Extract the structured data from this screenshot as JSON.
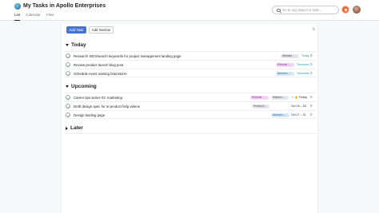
{
  "header": {
    "title": "My Tasks in Apollo Enterprises",
    "more": "···",
    "tabs": [
      {
        "label": "List",
        "active": true
      },
      {
        "label": "Calendar",
        "active": false
      },
      {
        "label": "Files",
        "active": false
      }
    ],
    "search_placeholder": "Go to any project or task..."
  },
  "toolbar": {
    "add_task_label": "Add Task",
    "add_section_label": "Add Section"
  },
  "colors": {
    "accent": "#4573d2",
    "orange": "#f06a3c",
    "due_today": "#2d9b6c",
    "due_tomorrow": "#1a9ea8"
  },
  "sections": {
    "today": {
      "title": "Today",
      "tasks": [
        {
          "name": "Research SEO/search keywords for project management landing page",
          "tag": "Website ...",
          "tag_bg": "#e4e6e9",
          "tag_fg": "#4a4f57",
          "due": "Today",
          "due_color": "#2d9b6c"
        },
        {
          "name": "Review product launch blog post",
          "tag": "Editorial ...",
          "tag_bg": "#f2d7f5",
          "tag_fg": "#7b2f86",
          "due": "Tomorrow",
          "due_color": "#1a9ea8"
        },
        {
          "name": "Schedule event naming brainstorm",
          "tag": "Annual c...",
          "tag_bg": "#d5e8f7",
          "tag_fg": "#2a5e8c",
          "due": "Tomorrow",
          "due_color": "#1a9ea8"
        }
      ]
    },
    "upcoming": {
      "title": "Upcoming",
      "tasks": [
        {
          "name": "Career tips series #2: marketing",
          "tag": "Editorial ...",
          "tag_bg": "#f2d7f5",
          "tag_fg": "#7b2f86",
          "tag2": "Mission ...",
          "tag2_bg": "#e4e6e9",
          "tag2_fg": "#4a4f57",
          "likes": "1",
          "due": "Friday",
          "due_color": "#1e1f21"
        },
        {
          "name": "Draft design spec for in-product help videos",
          "tag": "Product l...",
          "tag_bg": "#e4e6e9",
          "tag_fg": "#4a4f57",
          "due": "Oct 16 – 18",
          "due_color": "#1e1f21"
        },
        {
          "name": "Design landing page",
          "tag": "Annual c...",
          "tag_bg": "#d5e8f7",
          "tag_fg": "#2a5e8c",
          "due": "Oct 17 – 31",
          "due_color": "#1e1f21"
        }
      ]
    },
    "later": {
      "title": "Later"
    }
  },
  "icons": {
    "app_avatar": "workspace-avatar-icon",
    "search": "search-icon",
    "quick_add": "orange-plus-icon",
    "user": "user-avatar-icon",
    "settings": "view-settings-icon",
    "row_open": "chevron-right-icon",
    "complete": "check-circle-icon",
    "like": "thumbs-up-icon"
  }
}
